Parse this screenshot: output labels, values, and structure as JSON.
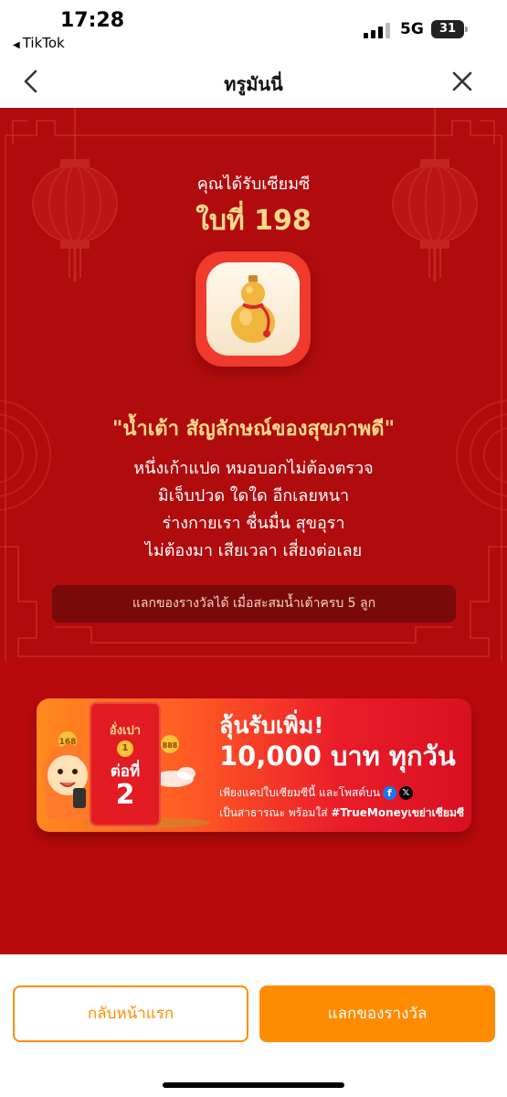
{
  "status_bar": {
    "time": "17:28",
    "back_app": "TikTok",
    "network": "5G",
    "battery": "31"
  },
  "header": {
    "title": "ทรูมันนี่",
    "back_icon": "chevron-left-icon",
    "close_icon": "close-icon"
  },
  "card": {
    "subtitle": "คุณได้รับเซียมซี",
    "number_label": "ใบที่ 198",
    "icon": "gourd-icon",
    "quote": "\"น้ำเต้า สัญลักษณ์ของสุขภาพดี\"",
    "poem_lines": [
      "หนึ่งเก้าแปด หมอบอกไม่ต้องตรวจ",
      "มิเจ็บปวด ใดใด อีกเลยหนา",
      "ร่างกายเรา ชื่นมื่น สุขอุรา",
      "ไม่ต้องมา เสียเวลา เสี่ยงต่อเลย"
    ],
    "info": "แลกของรางวัลได้ เมื่อสะสมน้ำเต้าครบ 5 ลูก"
  },
  "banner": {
    "headline1": "ลุ้นรับเพิ่ม!",
    "headline2": "10,000 บาท ทุกวัน",
    "line1": "เพียงแคปใบเซียมซีนี้ และโพสต์บน",
    "line2_prefix": "เป็นสาธารณะ พร้อมใส่",
    "line2_hashtag": "#TrueMoneyเขย่าเซียมซี",
    "envelope_label": "อั่งเปา",
    "envelope_order_label": "ต่อที่",
    "envelope_order_number": "2",
    "coin_1": "168",
    "coin_2": "888",
    "coin_3": "1",
    "social_icons": [
      "facebook-icon",
      "x-icon"
    ]
  },
  "footer": {
    "home_button": "กลับหน้าแรก",
    "redeem_button": "แลกของรางวัล"
  },
  "colors": {
    "primary_red": "#b80a0c",
    "gold_text": "#ffd98a",
    "accent_orange": "#ff8c00"
  }
}
